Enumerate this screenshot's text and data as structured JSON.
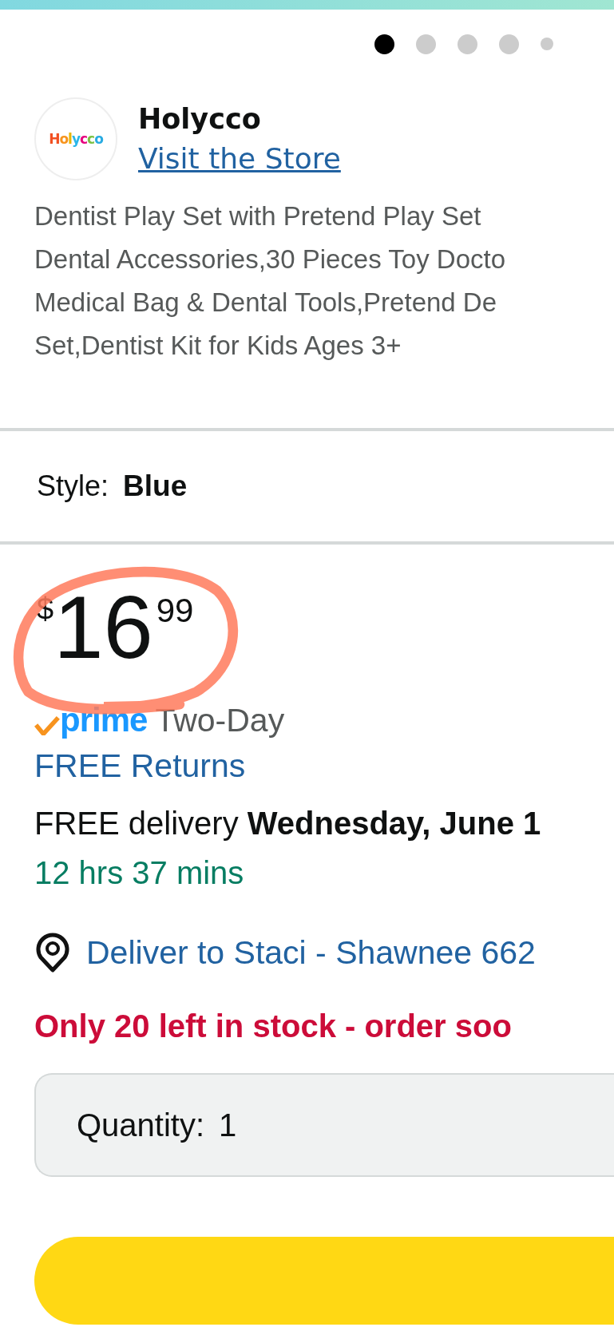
{
  "carousel_dots": [
    {
      "selected": true,
      "kind": "full"
    },
    {
      "selected": false,
      "kind": "full"
    },
    {
      "selected": false,
      "kind": "full"
    },
    {
      "selected": false,
      "kind": "full"
    },
    {
      "selected": false,
      "kind": "small"
    }
  ],
  "store": {
    "logo_text": "Holycco",
    "name": "Holycco",
    "link": "Visit the Store"
  },
  "title_lines": [
    "Dentist Play Set with Pretend Play Set",
    "Dental Accessories,30 Pieces Toy Docto",
    "Medical Bag & Dental Tools,Pretend De",
    "Set,Dentist Kit for Kids Ages 3+"
  ],
  "style": {
    "label": "Style:",
    "value": "Blue"
  },
  "price": {
    "currency": "$",
    "whole": "16",
    "fraction": "99",
    "circled": true
  },
  "prime": {
    "logo": "prime",
    "speed": "Two-Day"
  },
  "returns": "FREE Returns",
  "delivery": {
    "text": "FREE delivery **Wednesday, June 1**",
    "countdown": "12 hrs 37 mins"
  },
  "deliver_to": "Deliver to Staci - Shawnee 662",
  "stock": "Only 20 left in stock - order soo",
  "quantity": {
    "label": "Quantity:",
    "value": "1"
  },
  "buy_button": {
    "visible": true
  }
}
